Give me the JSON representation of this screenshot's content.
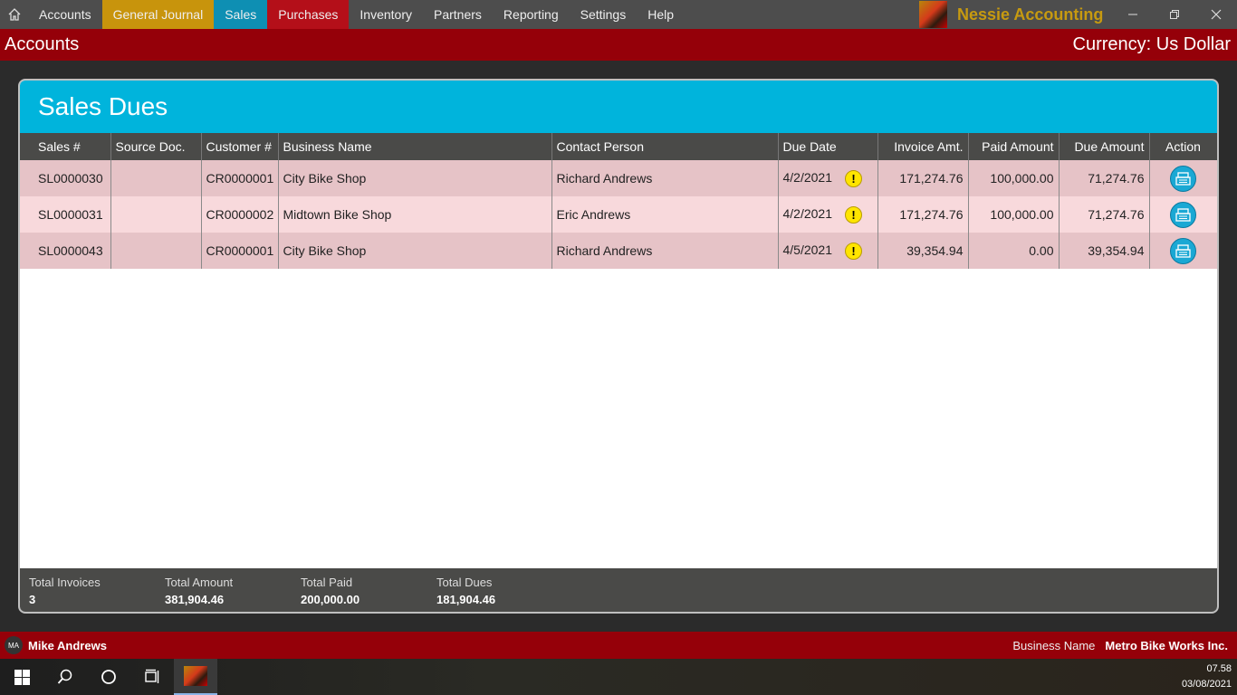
{
  "menu": {
    "items": [
      "Accounts",
      "General Journal",
      "Sales",
      "Purchases",
      "Inventory",
      "Partners",
      "Reporting",
      "Settings",
      "Help"
    ],
    "app_name": "Nessie Accounting",
    "colors": {
      "general_journal": "#c8940c",
      "sales": "#0e8fb3",
      "purchases": "#b40f19",
      "brand": "#c79a10"
    }
  },
  "titlebar": {
    "page_title": "Accounts",
    "currency": "Currency: Us Dollar"
  },
  "panel": {
    "title": "Sales Dues",
    "columns": [
      "Sales #",
      "Source Doc.",
      "Customer #",
      "Business Name",
      "Contact Person",
      "Due Date",
      "Invoice Amt.",
      "Paid Amount",
      "Due Amount",
      "Action"
    ],
    "rows": [
      {
        "sales": "SL0000030",
        "source": "",
        "customer": "CR0000001",
        "business": "City Bike Shop",
        "contact": "Richard Andrews",
        "due_date": "4/2/2021",
        "invoice": "171,274.76",
        "paid": "100,000.00",
        "due": "71,274.76"
      },
      {
        "sales": "SL0000031",
        "source": "",
        "customer": "CR0000002",
        "business": "Midtown Bike Shop",
        "contact": "Eric Andrews",
        "due_date": "4/2/2021",
        "invoice": "171,274.76",
        "paid": "100,000.00",
        "due": "71,274.76"
      },
      {
        "sales": "SL0000043",
        "source": "",
        "customer": "CR0000001",
        "business": "City Bike Shop",
        "contact": "Richard Andrews",
        "due_date": "4/5/2021",
        "invoice": "39,354.94",
        "paid": "0.00",
        "due": "39,354.94"
      }
    ],
    "warning_icon": "!",
    "footer": {
      "total_invoices_label": "Total Invoices",
      "total_invoices": "3",
      "total_amount_label": "Total Amount",
      "total_amount": "381,904.46",
      "total_paid_label": "Total Paid",
      "total_paid": "200,000.00",
      "total_dues_label": "Total Dues",
      "total_dues": "181,904.46"
    }
  },
  "status": {
    "initials": "MA",
    "user_name": "Mike Andrews",
    "business_label": "Business Name",
    "business_name": "Metro Bike Works Inc."
  },
  "taskbar": {
    "time": "07.58",
    "date": "03/08/2021"
  }
}
